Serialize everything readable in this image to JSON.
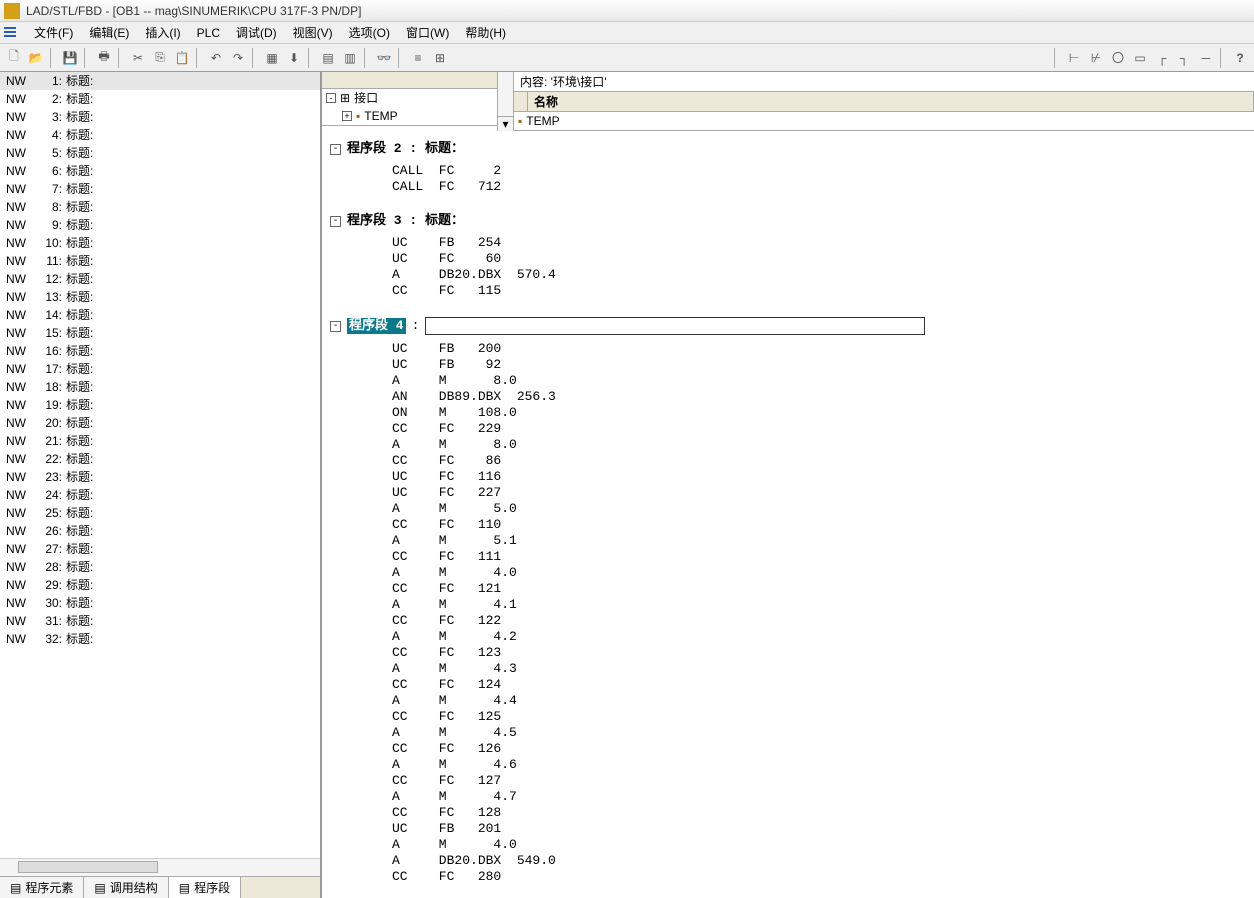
{
  "title": "LAD/STL/FBD  - [OB1 -- mag\\SINUMERIK\\CPU 317F-3 PN/DP]",
  "menu": {
    "file": "文件(F)",
    "edit": "编辑(E)",
    "insert": "插入(I)",
    "plc": "PLC",
    "debug": "调试(D)",
    "view": "视图(V)",
    "options": "选项(O)",
    "window": "窗口(W)",
    "help": "帮助(H)"
  },
  "nw": {
    "prefix": "NW",
    "title_label": "标题:",
    "items": [
      1,
      2,
      3,
      4,
      5,
      6,
      7,
      8,
      9,
      10,
      11,
      12,
      13,
      14,
      15,
      16,
      17,
      18,
      19,
      20,
      21,
      22,
      23,
      24,
      25,
      26,
      27,
      28,
      29,
      30,
      31,
      32
    ]
  },
  "left_tabs": {
    "t1": "程序元素",
    "t2": "调用结构",
    "t3": "程序段"
  },
  "header": {
    "content_label": "内容: '环境\\接口'",
    "iface": "接口",
    "temp": "TEMP",
    "name_col": "名称",
    "temp2": "TEMP"
  },
  "seg2": {
    "title": "程序段  2 : 标题：",
    "lines": [
      "CALL  FC     2",
      "CALL  FC   712"
    ]
  },
  "seg3": {
    "title": "程序段  3 : 标题：",
    "lines": [
      "UC    FB   254",
      "UC    FC    60",
      "A     DB20.DBX  570.4",
      "CC    FC   115"
    ]
  },
  "seg4": {
    "label": "程序段  4",
    "lines": [
      "UC    FB   200",
      "UC    FB    92",
      "A     M      8.0",
      "AN    DB89.DBX  256.3",
      "ON    M    108.0",
      "CC    FC   229",
      "A     M      8.0",
      "CC    FC    86",
      "UC    FC   116",
      "UC    FC   227",
      "A     M      5.0",
      "CC    FC   110",
      "A     M      5.1",
      "CC    FC   111",
      "A     M      4.0",
      "CC    FC   121",
      "A     M      4.1",
      "CC    FC   122",
      "A     M      4.2",
      "CC    FC   123",
      "A     M      4.3",
      "CC    FC   124",
      "A     M      4.4",
      "CC    FC   125",
      "A     M      4.5",
      "CC    FC   126",
      "A     M      4.6",
      "CC    FC   127",
      "A     M      4.7",
      "CC    FC   128",
      "UC    FB   201",
      "A     M      4.0",
      "A     DB20.DBX  549.0",
      "CC    FC   280"
    ]
  }
}
